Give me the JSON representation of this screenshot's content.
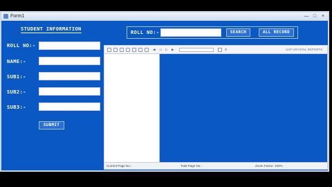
{
  "window": {
    "title": "Form1",
    "min_label": "—",
    "max_label": "□",
    "close_label": "×"
  },
  "form": {
    "heading": "STUDENT INFORMATION",
    "fields": [
      {
        "label": "ROLL NO:-",
        "value": ""
      },
      {
        "label": "NAME:-",
        "value": ""
      },
      {
        "label": "SUB1:-",
        "value": ""
      },
      {
        "label": "SUB2:-",
        "value": ""
      },
      {
        "label": "SUB3:-",
        "value": ""
      }
    ],
    "submit_label": "SUBMIT"
  },
  "search": {
    "label": "ROLL NO:-",
    "value": "",
    "search_label": "SEARCH",
    "all_label": "ALL RECORD"
  },
  "viewer": {
    "brand": "SAP CRYSTAL REPORTS",
    "status_page": "Current Page No.:",
    "status_total": "Total Page No.:",
    "status_zoom": "Zoom Factor: 100%"
  },
  "colors": {
    "form_bg": "#0a58c4",
    "button_bg": "#2a6fd6"
  }
}
